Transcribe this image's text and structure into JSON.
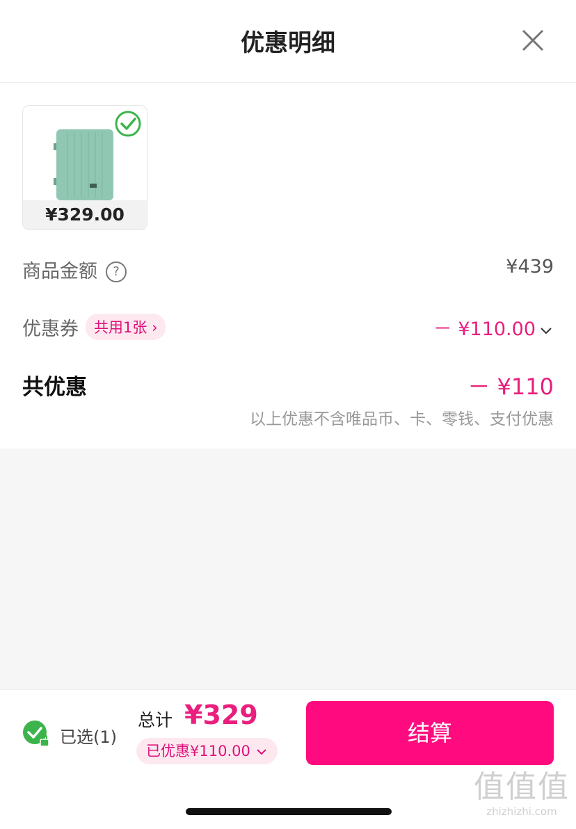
{
  "header": {
    "title": "优惠明细"
  },
  "product": {
    "price": "¥329.00"
  },
  "rows": {
    "goods_amount_label": "商品金额",
    "goods_amount_value": "¥439",
    "coupon_label": "优惠券",
    "coupon_pill": "共用1张",
    "coupon_value": "－ ¥110.00",
    "total_discount_label": "共优惠",
    "total_discount_value": "－ ¥110",
    "note": "以上优惠不含唯品币、卡、零钱、支付优惠"
  },
  "bottom": {
    "selected": "已选(1)",
    "total_label": "总计",
    "total_amount": "¥329",
    "saved": "已优惠¥110.00",
    "checkout": "结算"
  },
  "watermark": {
    "logo_text": "值值值",
    "site": "zhizhizhi.com"
  },
  "colors": {
    "accent": "#ff0b7f",
    "accent_text": "#e91e7d",
    "check_green": "#3cb44b",
    "item_green": "#8fc7b2"
  },
  "icons": [
    "close-icon",
    "check-circle-icon",
    "help-icon",
    "chevron-right-icon",
    "chevron-down-icon",
    "lock-icon"
  ]
}
